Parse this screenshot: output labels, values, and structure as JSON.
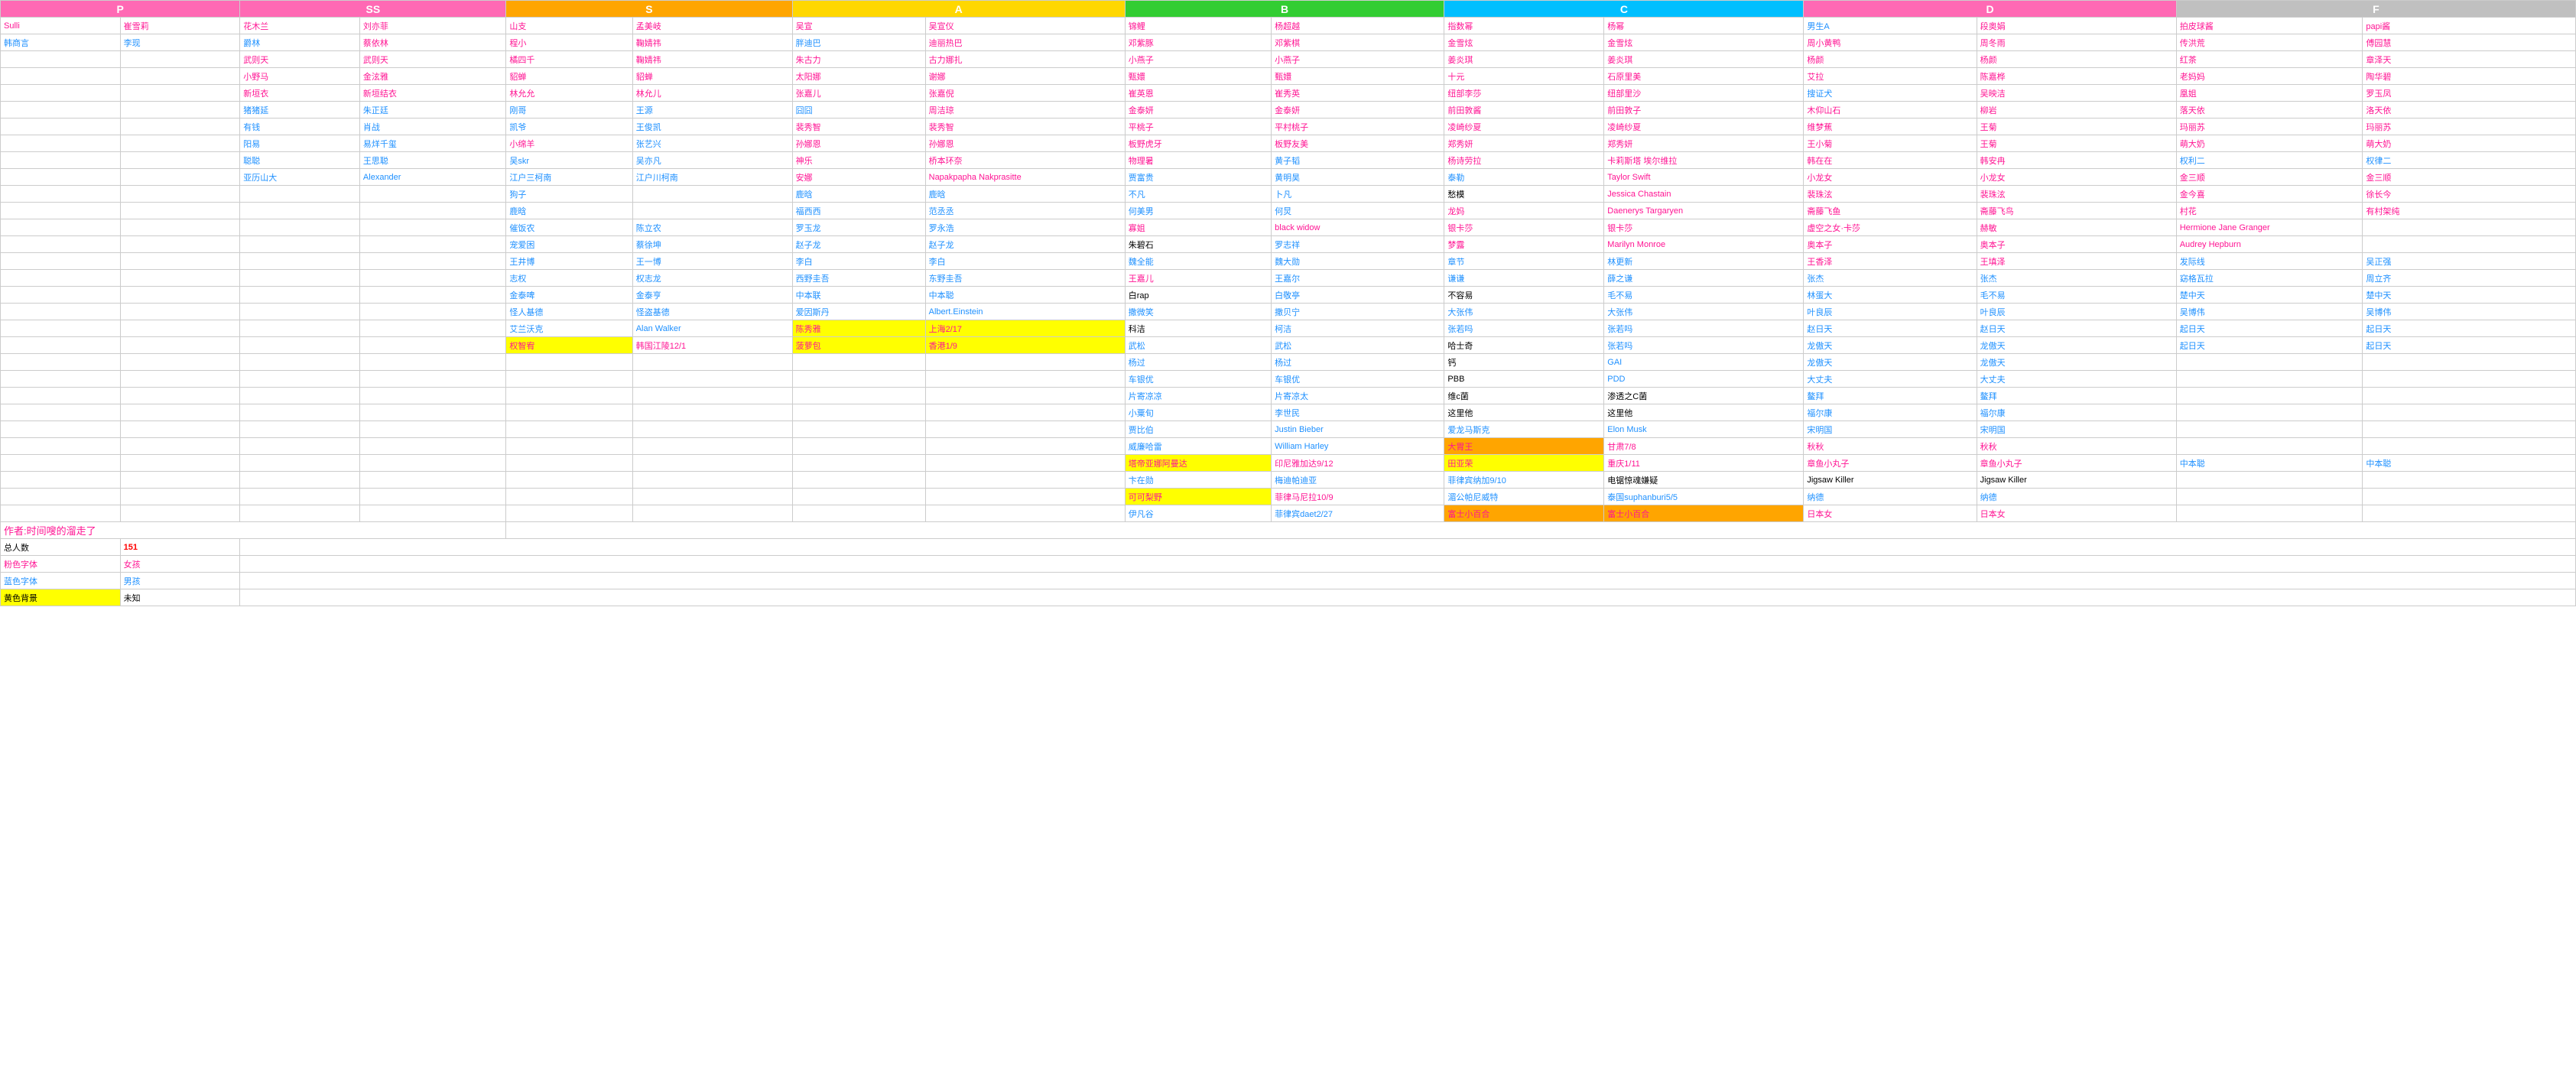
{
  "headers": {
    "col1_label": "",
    "col2_label": "",
    "P": "P",
    "SS": "SS",
    "S": "S",
    "A": "A",
    "A2": "A",
    "B": "B",
    "B2": "B",
    "C": "C",
    "C2": "C",
    "D": "D",
    "D2": "D",
    "F": "F",
    "F2": "F"
  },
  "subheaders": {
    "sulli": "Sulli",
    "崔雪莉": "崔雪莉",
    "花木兰": "花木兰",
    "刘亦菲": "刘亦菲",
    "山支": "山支",
    "孟美岐": "孟美岐",
    "吴宣": "吴宣",
    "吴宣仪": "吴宣仪",
    "锦鲤": "锦鲤",
    "杨超越": "杨超越",
    "指数幂": "指数幂",
    "杨幂": "杨幂",
    "男生A": "男生A",
    "段奥娟": "段奥娟",
    "拍皮球酱": "拍皮球酱",
    "papi酱": "papi酱"
  },
  "rows": [
    {
      "c1": "Sulli",
      "c1_class": "c-pink",
      "c2": "崔雪莉",
      "c2_class": "c-pink",
      "c3": "花木兰",
      "c3_class": "c-pink",
      "c4": "刘亦菲",
      "c4_class": "c-pink",
      "c5": "山支",
      "c5_class": "c-pink",
      "c6": "孟美岐",
      "c6_class": "c-pink",
      "c7": "吴宣",
      "c7_class": "c-pink",
      "c8": "吴宣仪",
      "c8_class": "c-pink",
      "c9": "锦鲤",
      "c9_class": "c-pink",
      "c10": "杨超越",
      "c10_class": "c-pink",
      "c11": "指数幂",
      "c11_class": "c-pink",
      "c12": "杨幂",
      "c12_class": "c-pink",
      "c13": "男生A",
      "c13_class": "c-blue",
      "c14": "段奥娟",
      "c14_class": "c-pink",
      "c15": "拍皮球酱",
      "c15_class": "c-pink",
      "c16": "papi酱",
      "c16_class": "c-pink"
    },
    {
      "c1": "韩商言",
      "c1_class": "c-blue",
      "c2": "李现",
      "c2_class": "c-blue",
      "c3": "爵林",
      "c3_class": "c-blue",
      "c4": "蔡依林",
      "c4_class": "c-pink",
      "c5": "程小",
      "c5_class": "c-pink",
      "c6": "鞠婧祎",
      "c6_class": "c-pink",
      "c7": "胖迪巴",
      "c7_class": "c-blue",
      "c8": "迪丽热巴",
      "c8_class": "c-pink",
      "c9": "邓紫豚",
      "c9_class": "c-pink",
      "c10": "邓紫棋",
      "c10_class": "c-pink",
      "c11": "金雪炫",
      "c11_class": "c-pink",
      "c12": "金雪炫",
      "c12_class": "c-pink",
      "c13": "周小黄鸭",
      "c13_class": "c-pink",
      "c14": "周冬雨",
      "c14_class": "c-pink",
      "c15": "传洪荒",
      "c15_class": "c-pink",
      "c16": "傅园慧",
      "c16_class": "c-pink"
    },
    {
      "c1": "",
      "c2": "",
      "c3": "武则天",
      "c3_class": "c-pink",
      "c4": "武则天",
      "c4_class": "c-pink",
      "c5": "橘四千",
      "c5_class": "c-pink",
      "c6": "鞠婧祎",
      "c6_class": "c-pink",
      "c7": "朱古力",
      "c7_class": "c-pink",
      "c8": "古力娜扎",
      "c8_class": "c-pink",
      "c9": "小燕子",
      "c9_class": "c-pink",
      "c10": "小燕子",
      "c10_class": "c-pink",
      "c11": "姜炎琪",
      "c11_class": "c-pink",
      "c12": "姜炎琪",
      "c12_class": "c-pink",
      "c13": "杨颜",
      "c13_class": "c-pink",
      "c14": "杨颜",
      "c14_class": "c-pink",
      "c15": "红茶",
      "c15_class": "c-pink",
      "c16": "章泽天",
      "c16_class": "c-pink"
    },
    {
      "c1": "",
      "c2": "",
      "c3": "小野马",
      "c3_class": "c-pink",
      "c4": "金泫雅",
      "c4_class": "c-pink",
      "c5": "貂蝉",
      "c5_class": "c-pink",
      "c6": "貂蝉",
      "c6_class": "c-pink",
      "c7": "太阳娜",
      "c7_class": "c-pink",
      "c8": "谢娜",
      "c8_class": "c-pink",
      "c9": "甄嬛",
      "c9_class": "c-pink",
      "c10": "甄嬛",
      "c10_class": "c-pink",
      "c11": "十元",
      "c11_class": "c-pink",
      "c12": "石原里美",
      "c12_class": "c-pink",
      "c13": "艾拉",
      "c13_class": "c-pink",
      "c14": "陈嘉桦",
      "c14_class": "c-pink",
      "c15": "老妈妈",
      "c15_class": "c-pink",
      "c16": "陶华碧",
      "c16_class": "c-pink"
    },
    {
      "c1": "",
      "c2": "",
      "c3": "新垣衣",
      "c3_class": "c-pink",
      "c4": "新垣结衣",
      "c4_class": "c-pink",
      "c5": "林允允",
      "c5_class": "c-pink",
      "c6": "林允儿",
      "c6_class": "c-pink",
      "c7": "张嘉儿",
      "c7_class": "c-pink",
      "c8": "张嘉倪",
      "c8_class": "c-pink",
      "c9": "崔英恩",
      "c9_class": "c-pink",
      "c10": "崔秀英",
      "c10_class": "c-pink",
      "c11": "纽部李莎",
      "c11_class": "c-pink",
      "c12": "纽部里沙",
      "c12_class": "c-pink",
      "c13": "搜证犬",
      "c13_class": "c-blue",
      "c14": "吴映洁",
      "c14_class": "c-pink",
      "c15": "凰姐",
      "c15_class": "c-pink",
      "c16": "罗玉凤",
      "c16_class": "c-pink"
    },
    {
      "c1": "",
      "c2": "",
      "c3": "猪猪延",
      "c3_class": "c-blue",
      "c4": "朱正廷",
      "c4_class": "c-blue",
      "c5": "刚哥",
      "c5_class": "c-blue",
      "c6": "王源",
      "c6_class": "c-blue",
      "c7": "囧囧",
      "c7_class": "c-blue",
      "c8": "周洁琼",
      "c8_class": "c-pink",
      "c9": "金泰妍",
      "c9_class": "c-pink",
      "c10": "金泰妍",
      "c10_class": "c-pink",
      "c11": "前田敦酱",
      "c11_class": "c-pink",
      "c12": "前田敦子",
      "c12_class": "c-pink",
      "c13": "木仰山石",
      "c13_class": "c-pink",
      "c14": "柳岩",
      "c14_class": "c-pink",
      "c15": "落天依",
      "c15_class": "c-pink",
      "c16": "洛天依",
      "c16_class": "c-pink"
    },
    {
      "c1": "",
      "c2": "",
      "c3": "有钱",
      "c3_class": "c-blue",
      "c4": "肖战",
      "c4_class": "c-blue",
      "c5": "凯爷",
      "c5_class": "c-blue",
      "c6": "王俊凯",
      "c6_class": "c-blue",
      "c7": "裴秀智",
      "c7_class": "c-pink",
      "c8": "裴秀智",
      "c8_class": "c-pink",
      "c9": "平桃子",
      "c9_class": "c-pink",
      "c10": "平村桃子",
      "c10_class": "c-pink",
      "c11": "凌崎纱夏",
      "c11_class": "c-pink",
      "c12": "凌崎纱夏",
      "c12_class": "c-pink",
      "c13": "维梦蕉",
      "c13_class": "c-pink",
      "c14": "王菊",
      "c14_class": "c-pink",
      "c15": "玛丽苏",
      "c15_class": "c-pink",
      "c16": "玛丽苏",
      "c16_class": "c-pink"
    },
    {
      "c1": "",
      "c2": "",
      "c3": "阳易",
      "c3_class": "c-blue",
      "c4": "易烊千玺",
      "c4_class": "c-blue",
      "c5": "小绵羊",
      "c5_class": "c-pink",
      "c6": "张艺兴",
      "c6_class": "c-blue",
      "c7": "孙娜恩",
      "c7_class": "c-pink",
      "c8": "孙娜恩",
      "c8_class": "c-pink",
      "c9": "板野虎牙",
      "c9_class": "c-pink",
      "c10": "板野友美",
      "c10_class": "c-pink",
      "c11": "郑秀妍",
      "c11_class": "c-pink",
      "c12": "郑秀妍",
      "c12_class": "c-pink",
      "c13": "王小菊",
      "c13_class": "c-pink",
      "c14": "王菊",
      "c14_class": "c-pink",
      "c15": "萌大奶",
      "c15_class": "c-pink",
      "c16": "萌大奶",
      "c16_class": "c-pink"
    },
    {
      "c1": "",
      "c2": "",
      "c3": "聪聪",
      "c3_class": "c-blue",
      "c4": "王思聪",
      "c4_class": "c-blue",
      "c5": "吴skr",
      "c5_class": "c-blue",
      "c6": "吴亦凡",
      "c6_class": "c-blue",
      "c7": "神乐",
      "c7_class": "c-pink",
      "c8": "桥本环奈",
      "c8_class": "c-pink",
      "c9": "物理暑",
      "c9_class": "c-pink",
      "c10": "黄子韬",
      "c10_class": "c-blue",
      "c11": "杨诗劳拉",
      "c11_class": "c-pink",
      "c12": "卡莉斯塔 埃尔维拉",
      "c12_class": "c-pink",
      "c13": "韩在在",
      "c13_class": "c-pink",
      "c14": "韩安冉",
      "c14_class": "c-pink",
      "c15": "权利二",
      "c15_class": "c-blue",
      "c16": "权律二",
      "c16_class": "c-blue"
    },
    {
      "c1": "",
      "c2": "",
      "c3": "亚历山大",
      "c3_class": "c-blue",
      "c4": "Alexander",
      "c4_class": "c-blue",
      "c5": "江户三柯南",
      "c5_class": "c-blue",
      "c6": "江户川柯南",
      "c6_class": "c-blue",
      "c7": "安娜",
      "c7_class": "c-pink",
      "c8": "Napakpapha Nakprasitte",
      "c8_class": "c-pink",
      "c9": "贾富贵",
      "c9_class": "c-blue",
      "c10": "黄明昊",
      "c10_class": "c-blue",
      "c11": "泰勒",
      "c11_class": "c-blue",
      "c12": "Taylor Swift",
      "c12_class": "c-pink",
      "c13": "小龙女",
      "c13_class": "c-pink",
      "c14": "小龙女",
      "c14_class": "c-pink",
      "c15": "金三顺",
      "c15_class": "c-pink",
      "c16": "金三顺",
      "c16_class": "c-pink"
    },
    {
      "c1": "",
      "c2": "",
      "c3": "",
      "c4": "",
      "c5": "狗子",
      "c5_class": "c-blue",
      "c6": "",
      "c6_class": "c-black",
      "c7": "鹿晗",
      "c7_class": "c-blue",
      "c8": "鹿晗",
      "c8_class": "c-blue",
      "c9": "不凡",
      "c9_class": "c-blue",
      "c10": "卜凡",
      "c10_class": "c-blue",
      "c11": "愁模",
      "c11_class": "c-black",
      "c12": "Jessica Chastain",
      "c12_class": "c-pink",
      "c13": "裴珠泫",
      "c13_class": "c-pink",
      "c14": "裴珠泫",
      "c14_class": "c-pink",
      "c15": "金今喜",
      "c15_class": "c-pink",
      "c16": "徐长今",
      "c16_class": "c-pink"
    },
    {
      "c1": "",
      "c2": "",
      "c3": "",
      "c4": "",
      "c5": "鹿晗",
      "c5_class": "c-blue",
      "c6": "",
      "c6_class": "c-black",
      "c7": "福西西",
      "c7_class": "c-blue",
      "c8": "范丞丞",
      "c8_class": "c-blue",
      "c9": "何美男",
      "c9_class": "c-blue",
      "c10": "何炅",
      "c10_class": "c-blue",
      "c11": "龙妈",
      "c11_class": "c-pink",
      "c12": "Daenerys Targaryen",
      "c12_class": "c-pink",
      "c13": "斋藤飞鱼",
      "c13_class": "c-pink",
      "c14": "斋藤飞鸟",
      "c14_class": "c-pink",
      "c15": "村花",
      "c15_class": "c-pink",
      "c16": "有村架纯",
      "c16_class": "c-pink"
    },
    {
      "c1": "",
      "c2": "",
      "c3": "",
      "c4": "",
      "c5": "催饭农",
      "c5_class": "c-blue",
      "c6": "陈立农",
      "c6_class": "c-blue",
      "c7": "罗玉龙",
      "c7_class": "c-blue",
      "c8": "罗永浩",
      "c8_class": "c-blue",
      "c9": "寡姐",
      "c9_class": "c-pink",
      "c10": "black widow",
      "c10_class": "c-pink",
      "c11": "银卡莎",
      "c11_class": "c-pink",
      "c12": "银卡莎",
      "c12_class": "c-pink",
      "c13": "虚空之女·卡莎",
      "c13_class": "c-pink",
      "c14": "赫敏",
      "c14_class": "c-pink",
      "c15": "Hermione Jane Granger",
      "c15_class": "c-pink",
      "c16": ""
    },
    {
      "c1": "",
      "c2": "",
      "c3": "",
      "c4": "",
      "c5": "宠爱困",
      "c5_class": "c-blue",
      "c6": "蔡徐坤",
      "c6_class": "c-blue",
      "c7": "赵子龙",
      "c7_class": "c-blue",
      "c8": "赵子龙",
      "c8_class": "c-blue",
      "c9": "朱碧石",
      "c9_class": "c-black",
      "c10": "罗志祥",
      "c10_class": "c-blue",
      "c11": "梦露",
      "c11_class": "c-pink",
      "c12": "Marilyn Monroe",
      "c12_class": "c-pink",
      "c13": "奥本子",
      "c13_class": "c-pink",
      "c14": "奥本子",
      "c14_class": "c-pink",
      "c15": "Audrey Hepburn",
      "c15_class": "c-pink",
      "c16": ""
    },
    {
      "c1": "",
      "c2": "",
      "c3": "",
      "c4": "",
      "c5": "王井博",
      "c5_class": "c-blue",
      "c6": "王一博",
      "c6_class": "c-blue",
      "c7": "李白",
      "c7_class": "c-blue",
      "c8": "李白",
      "c8_class": "c-blue",
      "c9": "魏全能",
      "c9_class": "c-blue",
      "c10": "魏大勋",
      "c10_class": "c-blue",
      "c11": "章节",
      "c11_class": "c-blue",
      "c12": "林更新",
      "c12_class": "c-blue",
      "c13": "王香泽",
      "c13_class": "c-pink",
      "c14": "王填泽",
      "c14_class": "c-pink",
      "c15": "发际线",
      "c15_class": "c-blue",
      "c16": "吴正强",
      "c16_class": "c-blue"
    },
    {
      "c1": "",
      "c2": "",
      "c3": "",
      "c4": "",
      "c5": "志权",
      "c5_class": "c-blue",
      "c6": "权志龙",
      "c6_class": "c-blue",
      "c7": "西野圭吾",
      "c7_class": "c-blue",
      "c8": "东野圭吾",
      "c8_class": "c-blue",
      "c9": "王嘉儿",
      "c9_class": "c-pink",
      "c10": "王嘉尔",
      "c10_class": "c-blue",
      "c11": "谦谦",
      "c11_class": "c-blue",
      "c12": "薛之谦",
      "c12_class": "c-blue",
      "c13": "张杰",
      "c13_class": "c-blue",
      "c14": "张杰",
      "c14_class": "c-blue",
      "c15": "窈格瓦拉",
      "c15_class": "c-blue",
      "c16": "周立齐",
      "c16_class": "c-blue"
    },
    {
      "c1": "",
      "c2": "",
      "c3": "",
      "c4": "",
      "c5": "金泰啤",
      "c5_class": "c-blue",
      "c6": "金泰亨",
      "c6_class": "c-blue",
      "c7": "中本联",
      "c7_class": "c-blue",
      "c8": "中本聪",
      "c8_class": "c-blue",
      "c9": "白rap",
      "c9_class": "c-black",
      "c10": "白敬亭",
      "c10_class": "c-blue",
      "c11": "不容易",
      "c11_class": "c-black",
      "c12": "毛不易",
      "c12_class": "c-blue",
      "c13": "林蛋大",
      "c13_class": "c-blue",
      "c14": "毛不易",
      "c14_class": "c-blue",
      "c15": "楚中天",
      "c15_class": "c-blue",
      "c16": "楚中天",
      "c16_class": "c-blue"
    },
    {
      "c1": "",
      "c2": "",
      "c3": "",
      "c4": "",
      "c5": "怪人基德",
      "c5_class": "c-blue",
      "c6": "怪盗基德",
      "c6_class": "c-blue",
      "c7": "爱因斯丹",
      "c7_class": "c-blue",
      "c8": "Albert.Einstein",
      "c8_class": "c-blue",
      "c9": "撒微笑",
      "c9_class": "c-blue",
      "c10": "撒贝宁",
      "c10_class": "c-blue",
      "c11": "大张伟",
      "c11_class": "c-blue",
      "c12": "大张伟",
      "c12_class": "c-blue",
      "c13": "叶良辰",
      "c13_class": "c-blue",
      "c14": "叶良辰",
      "c14_class": "c-blue",
      "c15": "吴博伟",
      "c15_class": "c-blue",
      "c16": "吴博伟",
      "c16_class": "c-blue"
    },
    {
      "c1": "",
      "c2": "",
      "c3": "",
      "c4": "",
      "c5": "艾兰沃克",
      "c5_class": "c-blue",
      "c6": "Alan Walker",
      "c6_class": "c-blue",
      "c7": "陈秀雅",
      "c7_class": "c-pink bg-yellow",
      "c8": "上海2/17",
      "c8_class": "c-pink bg-yellow",
      "c9": "科洁",
      "c9_class": "c-black",
      "c10": "柯洁",
      "c10_class": "c-blue",
      "c11": "张若吗",
      "c11_class": "c-blue",
      "c12": "张若吗",
      "c12_class": "c-blue",
      "c13": "赵日天",
      "c13_class": "c-blue",
      "c14": "赵日天",
      "c14_class": "c-blue",
      "c15": "起日天",
      "c15_class": "c-blue",
      "c16": "起日天",
      "c16_class": "c-blue"
    },
    {
      "c1": "",
      "c2": "",
      "c3": "",
      "c4": "",
      "c5": "权智宥",
      "c5_class": "c-pink bg-yellow",
      "c6": "韩国江陵12/1",
      "c6_class": "c-pink",
      "c7": "菠萝包",
      "c7_class": "c-pink bg-yellow",
      "c8": "香港1/9",
      "c8_class": "c-pink bg-yellow",
      "c9": "武松",
      "c9_class": "c-blue",
      "c10": "武松",
      "c10_class": "c-blue",
      "c11": "哈士奇",
      "c11_class": "c-black",
      "c12": "张若吗",
      "c12_class": "c-blue",
      "c13": "龙傲天",
      "c13_class": "c-blue",
      "c14": "龙傲天",
      "c14_class": "c-blue",
      "c15": "起日天",
      "c15_class": "c-blue",
      "c16": "起日天",
      "c16_class": "c-blue"
    },
    {
      "c1": "",
      "c2": "",
      "c3": "",
      "c4": "",
      "c5": "",
      "c6": "",
      "c7": "",
      "c8": "",
      "c9": "杨过",
      "c9_class": "c-blue",
      "c10": "杨过",
      "c10_class": "c-blue",
      "c11": "钙",
      "c11_class": "c-black",
      "c12": "GAI",
      "c12_class": "c-blue",
      "c13": "龙傲天",
      "c13_class": "c-blue",
      "c14": "龙傲天",
      "c14_class": "c-blue",
      "c15": "",
      "c16": ""
    },
    {
      "c1": "",
      "c2": "",
      "c3": "",
      "c4": "",
      "c5": "",
      "c6": "",
      "c7": "",
      "c8": "",
      "c9": "车银优",
      "c9_class": "c-blue",
      "c10": "车银优",
      "c10_class": "c-blue",
      "c11": "PBB",
      "c11_class": "c-black",
      "c12": "PDD",
      "c12_class": "c-blue",
      "c13": "大丈夫",
      "c13_class": "c-blue",
      "c14": "大丈夫",
      "c14_class": "c-blue",
      "c15": "",
      "c16": ""
    },
    {
      "c1": "",
      "c2": "",
      "c3": "",
      "c4": "",
      "c5": "",
      "c6": "",
      "c7": "",
      "c8": "",
      "c9": "片寄凉凉",
      "c9_class": "c-blue",
      "c10": "片寄凉太",
      "c10_class": "c-blue",
      "c11": "维c菌",
      "c11_class": "c-black",
      "c12": "渗透之C菌",
      "c12_class": "c-black",
      "c13": "鳌拜",
      "c13_class": "c-blue",
      "c14": "鳌拜",
      "c14_class": "c-blue",
      "c15": "",
      "c16": ""
    },
    {
      "c1": "",
      "c2": "",
      "c3": "",
      "c4": "",
      "c5": "",
      "c6": "",
      "c7": "",
      "c8": "",
      "c9": "小粟旬",
      "c9_class": "c-blue",
      "c10": "李世民",
      "c10_class": "c-blue",
      "c11": "这里他",
      "c11_class": "c-black",
      "c12": "这里他",
      "c12_class": "c-black",
      "c13": "福尔康",
      "c13_class": "c-blue",
      "c14": "福尔康",
      "c14_class": "c-blue",
      "c15": "",
      "c16": ""
    },
    {
      "c1": "",
      "c2": "",
      "c3": "",
      "c4": "",
      "c5": "",
      "c6": "",
      "c7": "",
      "c8": "",
      "c9": "贾比伯",
      "c9_class": "c-blue",
      "c10": "Justin Bieber",
      "c10_class": "c-blue",
      "c11": "爱龙马斯克",
      "c11_class": "c-blue",
      "c12": "Elon Musk",
      "c12_class": "c-blue",
      "c13": "宋明国",
      "c13_class": "c-blue",
      "c14": "宋明国",
      "c14_class": "c-blue",
      "c15": "",
      "c16": ""
    },
    {
      "c1": "",
      "c2": "",
      "c3": "",
      "c4": "",
      "c5": "",
      "c6": "",
      "c7": "",
      "c8": "",
      "c9": "威廉哈雷",
      "c9_class": "c-blue",
      "c10": "William Harley",
      "c10_class": "c-blue",
      "c11": "大胃王",
      "c11_class": "c-pink bg-orange",
      "c12": "甘肃7/8",
      "c12_class": "c-pink",
      "c13": "秋秋",
      "c13_class": "c-pink",
      "c14": "秋秋",
      "c14_class": "c-pink",
      "c15": "",
      "c16": ""
    },
    {
      "c1": "",
      "c2": "",
      "c3": "",
      "c4": "",
      "c5": "",
      "c6": "",
      "c7": "",
      "c8": "",
      "c9": "塔帝亚娜阿曼达",
      "c9_class": "c-pink bg-yellow",
      "c10": "印尼雅加达9/12",
      "c10_class": "c-pink",
      "c11": "田亚荣",
      "c11_class": "c-pink bg-yellow",
      "c12": "重庆1/11",
      "c12_class": "c-pink",
      "c13": "章鱼小丸子",
      "c13_class": "c-pink",
      "c14": "章鱼小丸子",
      "c14_class": "c-pink",
      "c15": "中本聪",
      "c15_class": "c-blue",
      "c16": "中本聪",
      "c16_class": "c-blue"
    },
    {
      "c1": "",
      "c2": "",
      "c3": "",
      "c4": "",
      "c5": "",
      "c6": "",
      "c7": "",
      "c8": "",
      "c9": "卞在勋",
      "c9_class": "c-blue",
      "c10": "梅迪帕迪亚",
      "c10_class": "c-blue",
      "c11": "菲律宾纳加9/10",
      "c11_class": "c-blue",
      "c12": "电锯惊魂嫌疑",
      "c12_class": "c-black",
      "c13": "Jigsaw Killer",
      "c13_class": "c-black",
      "c14": "Jigsaw Killer",
      "c14_class": "c-black",
      "c15": "",
      "c16": ""
    },
    {
      "c1": "",
      "c2": "",
      "c3": "",
      "c4": "",
      "c5": "",
      "c6": "",
      "c7": "",
      "c8": "",
      "c9": "可可梨野",
      "c9_class": "c-pink bg-yellow",
      "c10": "菲律马尼拉10/9",
      "c10_class": "c-pink",
      "c11": "湄公帕尼威特",
      "c11_class": "c-blue",
      "c12": "泰国suphanburi5/5",
      "c12_class": "c-blue",
      "c13": "纳德",
      "c13_class": "c-blue",
      "c14": "纳德",
      "c14_class": "c-blue",
      "c15": "",
      "c16": ""
    },
    {
      "c1": "",
      "c2": "",
      "c3": "",
      "c4": "",
      "c5": "",
      "c6": "",
      "c7": "",
      "c8": "",
      "c9": "伊凡谷",
      "c9_class": "c-blue",
      "c10": "菲律宾daet2/27",
      "c10_class": "c-blue",
      "c11": "富士小百合",
      "c11_class": "c-pink bg-orange",
      "c12": "富士小百合",
      "c12_class": "c-pink bg-orange",
      "c13": "日本女",
      "c13_class": "c-pink",
      "c14": "日本女",
      "c14_class": "c-pink",
      "c15": "",
      "c16": ""
    }
  ],
  "bottom": {
    "author": "作者:时间嗖的溜走了",
    "total_label": "总人数",
    "total_value": "151",
    "pink_label": "粉色字体",
    "pink_value": "女孩",
    "blue_label": "蓝色字体",
    "blue_value": "男孩",
    "yellow_label": "黄色背景",
    "yellow_value": "未知"
  }
}
